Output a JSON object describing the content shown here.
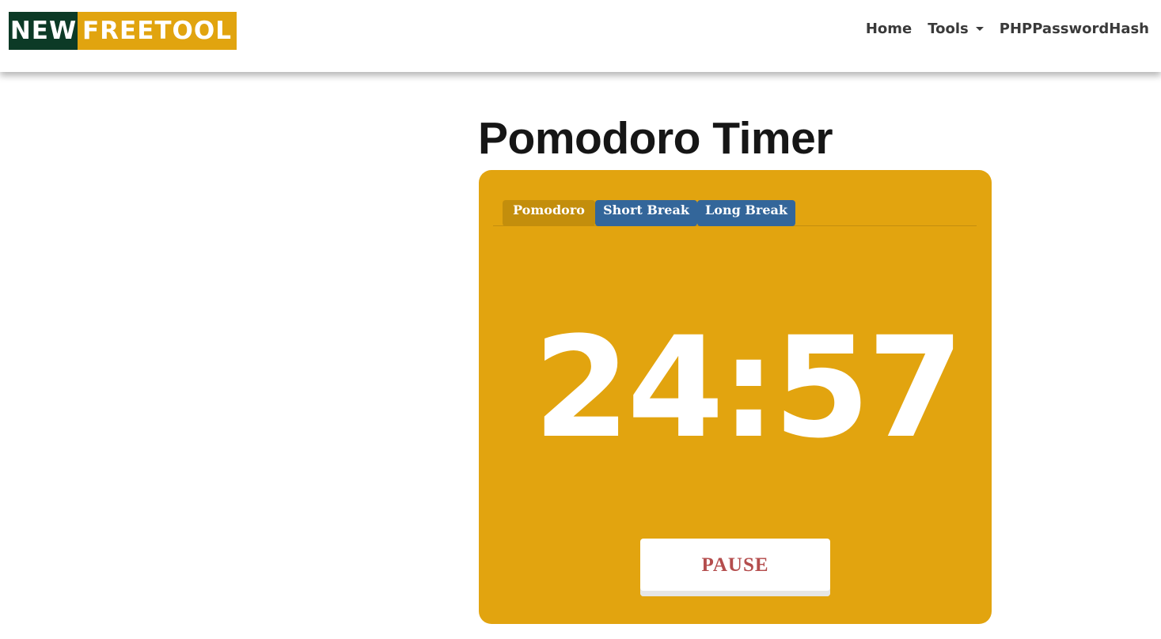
{
  "navbar": {
    "logo": {
      "part1": "NEW",
      "part2": "FREETOOL"
    },
    "links": {
      "home": "Home",
      "tools": "Tools",
      "php_password_hash": "PHPPasswordHash"
    }
  },
  "main": {
    "title": "Pomodoro Timer",
    "tabs": [
      {
        "label": "Pomodoro",
        "active": true
      },
      {
        "label": "Short Break",
        "active": false
      },
      {
        "label": "Long Break",
        "active": false
      }
    ],
    "timer": {
      "time": "24:57"
    },
    "pause_button_label": "PAUSE"
  },
  "icons": {
    "tools_dropdown": "caret-down-icon"
  },
  "colors": {
    "logo_dark": "#0c3a26",
    "logo_gold": "#e1a40f",
    "card_background": "#e2a40f",
    "active_tab": "#c38e0c",
    "inactive_tab": "#33669a",
    "pause_text": "#b44d4d"
  }
}
